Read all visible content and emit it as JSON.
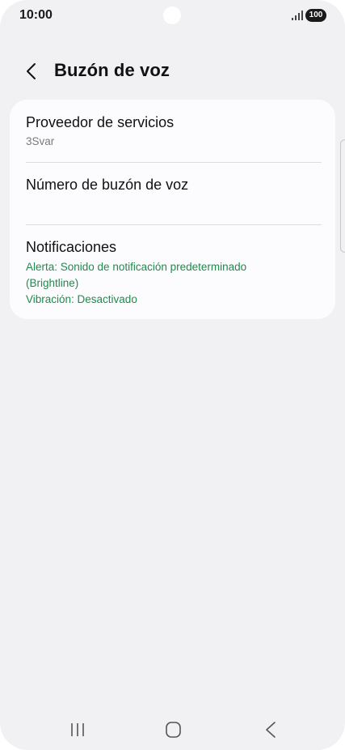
{
  "status_bar": {
    "time": "10:00",
    "battery": "100",
    "icons": [
      "signal-icon",
      "battery-icon"
    ]
  },
  "header": {
    "title": "Buzón de voz",
    "back_icon": "chevron-left-icon"
  },
  "settings": {
    "items": [
      {
        "title": "Proveedor de servicios",
        "value": "3Svar"
      },
      {
        "title": "Número de buzón de voz",
        "value": ""
      },
      {
        "title": "Notificaciones",
        "details": [
          "Alerta: Sonido de notificación predeterminado",
          "(Brightline)",
          "Vibración: Desactivado"
        ]
      }
    ]
  },
  "nav_bar": {
    "icons": [
      "recent-apps-icon",
      "home-icon",
      "back-icon"
    ]
  },
  "colors": {
    "background": "#f1f1f3",
    "card": "#fcfcfe",
    "accent_green": "#1f8a4c",
    "secondary_text": "#7a7a7a"
  }
}
